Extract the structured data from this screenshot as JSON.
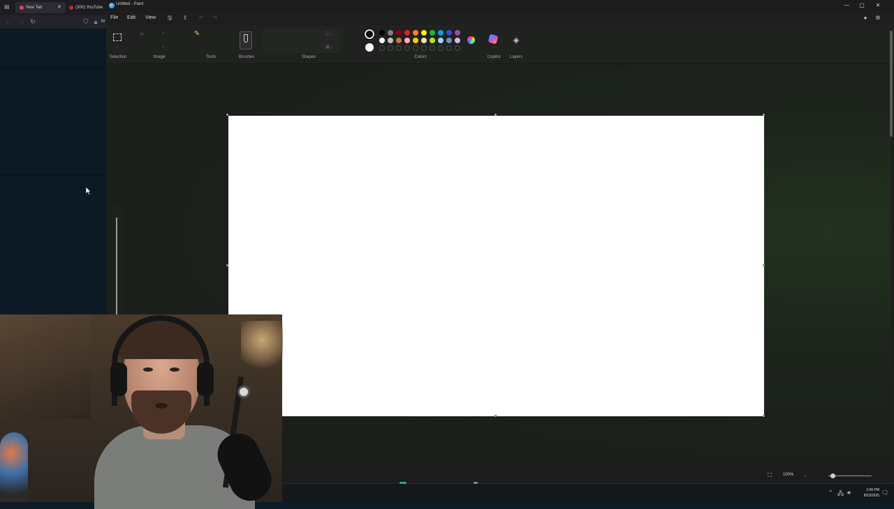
{
  "browser": {
    "tabs": [
      {
        "label": "New Tab",
        "active": true
      },
      {
        "label": "(300) YouTube",
        "active": false
      }
    ],
    "address_fragment": "tv"
  },
  "paint": {
    "window_title": "Untitled - Paint",
    "menu": [
      "File",
      "Edit",
      "View"
    ],
    "ribbon_groups": {
      "selection": "Selection",
      "image": "Image",
      "tools": "Tools",
      "brushes": "Brushes",
      "shapes": "Shapes",
      "colors": "Colors",
      "copilot": "Copilot",
      "layers": "Layers"
    },
    "colors": {
      "primary": "#000000",
      "secondary": "#ffffff",
      "palette_row1": [
        "#000000",
        "#7f7f7f",
        "#880015",
        "#ed1c24",
        "#ff7f27",
        "#fff200",
        "#22b14c",
        "#00a2e8",
        "#3f48cc",
        "#a349a4"
      ],
      "palette_row2": [
        "#ffffff",
        "#c3c3c3",
        "#b97a57",
        "#ffaec9",
        "#ffc90e",
        "#efe4b0",
        "#b5e61d",
        "#99d9ea",
        "#7092be",
        "#c8bfe7"
      ],
      "palette_row3_custom_slots": 10
    },
    "status": {
      "zoom": "100%",
      "zoom_slider_fraction": 0.1
    }
  },
  "taskbar": {
    "time": "1:06 PM",
    "date": "8/23/2025"
  }
}
